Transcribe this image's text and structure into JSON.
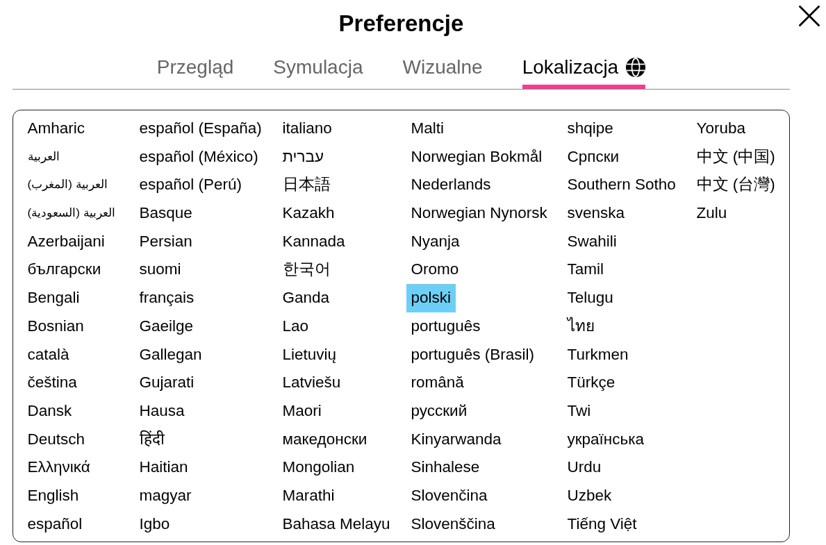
{
  "dialog": {
    "title": "Preferencje"
  },
  "tabs": [
    {
      "label": "Przegląd",
      "selected": false,
      "kind": "text"
    },
    {
      "label": "Symulacja",
      "selected": false,
      "kind": "text"
    },
    {
      "label": "Wizualne",
      "selected": false,
      "kind": "text"
    },
    {
      "label": "Lokalizacja",
      "selected": true,
      "kind": "text-icon"
    }
  ],
  "languages": [
    {
      "label": "Amharic",
      "selected": false
    },
    {
      "label": "العربية",
      "selected": false
    },
    {
      "label": "العربية (المغرب)",
      "selected": false
    },
    {
      "label": "العربية (السعودية)",
      "selected": false
    },
    {
      "label": "Azerbaijani",
      "selected": false
    },
    {
      "label": "български",
      "selected": false
    },
    {
      "label": "Bengali",
      "selected": false
    },
    {
      "label": "Bosnian",
      "selected": false
    },
    {
      "label": "català",
      "selected": false
    },
    {
      "label": "čeština",
      "selected": false
    },
    {
      "label": "Dansk",
      "selected": false
    },
    {
      "label": "Deutsch",
      "selected": false
    },
    {
      "label": "Ελληνικά",
      "selected": false
    },
    {
      "label": "English",
      "selected": false
    },
    {
      "label": "español",
      "selected": false
    },
    {
      "label": "español (España)",
      "selected": false
    },
    {
      "label": "español (México)",
      "selected": false
    },
    {
      "label": "español (Perú)",
      "selected": false
    },
    {
      "label": "Basque",
      "selected": false
    },
    {
      "label": "Persian",
      "selected": false
    },
    {
      "label": "suomi",
      "selected": false
    },
    {
      "label": "français",
      "selected": false
    },
    {
      "label": "Gaeilge",
      "selected": false
    },
    {
      "label": "Gallegan",
      "selected": false
    },
    {
      "label": "Gujarati",
      "selected": false
    },
    {
      "label": "Hausa",
      "selected": false
    },
    {
      "label": "हिंदी",
      "selected": false
    },
    {
      "label": "Haitian",
      "selected": false
    },
    {
      "label": "magyar",
      "selected": false
    },
    {
      "label": "Igbo",
      "selected": false
    },
    {
      "label": "italiano",
      "selected": false
    },
    {
      "label": "עברית",
      "selected": false
    },
    {
      "label": "日本語",
      "selected": false
    },
    {
      "label": "Kazakh",
      "selected": false
    },
    {
      "label": "Kannada",
      "selected": false
    },
    {
      "label": "한국어",
      "selected": false
    },
    {
      "label": "Ganda",
      "selected": false
    },
    {
      "label": "Lao",
      "selected": false
    },
    {
      "label": "Lietuvių",
      "selected": false
    },
    {
      "label": "Latviešu",
      "selected": false
    },
    {
      "label": "Maori",
      "selected": false
    },
    {
      "label": "македонски",
      "selected": false
    },
    {
      "label": "Mongolian",
      "selected": false
    },
    {
      "label": "Marathi",
      "selected": false
    },
    {
      "label": "Bahasa Melayu",
      "selected": false
    },
    {
      "label": "Malti",
      "selected": false
    },
    {
      "label": "Norwegian Bokmål",
      "selected": false
    },
    {
      "label": "Nederlands",
      "selected": false
    },
    {
      "label": "Norwegian Nynorsk",
      "selected": false
    },
    {
      "label": "Nyanja",
      "selected": false
    },
    {
      "label": "Oromo",
      "selected": false
    },
    {
      "label": "polski",
      "selected": true
    },
    {
      "label": "português",
      "selected": false
    },
    {
      "label": "português (Brasil)",
      "selected": false
    },
    {
      "label": "română",
      "selected": false
    },
    {
      "label": "русский",
      "selected": false
    },
    {
      "label": "Kinyarwanda",
      "selected": false
    },
    {
      "label": "Sinhalese",
      "selected": false
    },
    {
      "label": "Slovenčina",
      "selected": false
    },
    {
      "label": "Slovenščina",
      "selected": false
    },
    {
      "label": "shqipe",
      "selected": false
    },
    {
      "label": "Српски",
      "selected": false
    },
    {
      "label": "Southern Sotho",
      "selected": false
    },
    {
      "label": "svenska",
      "selected": false
    },
    {
      "label": "Swahili",
      "selected": false
    },
    {
      "label": "Tamil",
      "selected": false
    },
    {
      "label": "Telugu",
      "selected": false
    },
    {
      "label": "ไทย",
      "selected": false
    },
    {
      "label": "Turkmen",
      "selected": false
    },
    {
      "label": "Türkçe",
      "selected": false
    },
    {
      "label": "Twi",
      "selected": false
    },
    {
      "label": "українська",
      "selected": false
    },
    {
      "label": "Urdu",
      "selected": false
    },
    {
      "label": "Uzbek",
      "selected": false
    },
    {
      "label": "Tiếng Việt",
      "selected": false
    },
    {
      "label": "Yoruba",
      "selected": false
    },
    {
      "label": "中文 (中国)",
      "selected": false
    },
    {
      "label": "中文 (台灣)",
      "selected": false
    },
    {
      "label": "Zulu",
      "selected": false
    }
  ]
}
